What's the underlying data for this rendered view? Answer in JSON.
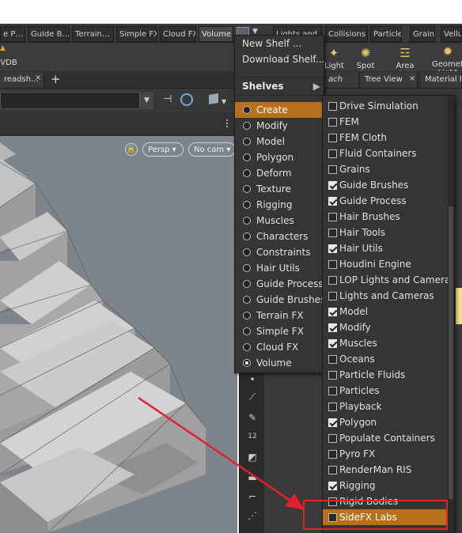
{
  "shelf_tabs": [
    "e P…",
    "Guide B…",
    "Terrain…",
    "Simple FX",
    "Cloud FX",
    "Volume",
    "Lights and…",
    "Collisions",
    "Particles",
    "Grains",
    "Vellum"
  ],
  "tools": {
    "left_partial": "VDB",
    "light": "Light",
    "spot_light": "Spot Light",
    "area_light": "Area Light",
    "geometry_light": "Geometry Light"
  },
  "pane_tabs": {
    "spreadsheet": "readsh…",
    "close": "×",
    "add": "+",
    "right1": "ach",
    "tree_view": "Tree View",
    "material": "Material Pa",
    "close2": "×"
  },
  "viewport": {
    "persp": "Persp",
    "nocam": "No cam"
  },
  "shelf_menu": {
    "new_shelf": "New Shelf ...",
    "download_shelf": "Download Shelf...",
    "shelves_header": "Shelves",
    "items": [
      {
        "label": "Create",
        "selected": false,
        "highlighted": true
      },
      {
        "label": "Modify",
        "selected": false
      },
      {
        "label": "Model",
        "selected": false
      },
      {
        "label": "Polygon",
        "selected": false
      },
      {
        "label": "Deform",
        "selected": false
      },
      {
        "label": "Texture",
        "selected": false
      },
      {
        "label": "Rigging",
        "selected": false
      },
      {
        "label": "Muscles",
        "selected": false
      },
      {
        "label": "Characters",
        "selected": false
      },
      {
        "label": "Constraints",
        "selected": false
      },
      {
        "label": "Hair Utils",
        "selected": false
      },
      {
        "label": "Guide Process",
        "selected": false
      },
      {
        "label": "Guide Brushes",
        "selected": false
      },
      {
        "label": "Terrain FX",
        "selected": false
      },
      {
        "label": "Simple FX",
        "selected": false
      },
      {
        "label": "Cloud FX",
        "selected": false
      },
      {
        "label": "Volume",
        "selected": true
      }
    ]
  },
  "shelves_submenu": {
    "items": [
      {
        "label": "Drive Simulation",
        "checked": false
      },
      {
        "label": "FEM",
        "checked": false
      },
      {
        "label": "FEM Cloth",
        "checked": false
      },
      {
        "label": "Fluid Containers",
        "checked": false
      },
      {
        "label": "Grains",
        "checked": false
      },
      {
        "label": "Guide Brushes",
        "checked": true
      },
      {
        "label": "Guide Process",
        "checked": true
      },
      {
        "label": "Hair Brushes",
        "checked": false
      },
      {
        "label": "Hair Tools",
        "checked": false
      },
      {
        "label": "Hair Utils",
        "checked": true
      },
      {
        "label": "Houdini Engine",
        "checked": false
      },
      {
        "label": "LOP Lights and Cameras",
        "checked": false
      },
      {
        "label": "Lights and Cameras",
        "checked": false
      },
      {
        "label": "Model",
        "checked": true
      },
      {
        "label": "Modify",
        "checked": true
      },
      {
        "label": "Muscles",
        "checked": true
      },
      {
        "label": "Oceans",
        "checked": false
      },
      {
        "label": "Particle Fluids",
        "checked": false
      },
      {
        "label": "Particles",
        "checked": false
      },
      {
        "label": "Playback",
        "checked": false
      },
      {
        "label": "Polygon",
        "checked": true
      },
      {
        "label": "Populate Containers",
        "checked": false
      },
      {
        "label": "Pyro FX",
        "checked": false
      },
      {
        "label": "RenderMan RIS",
        "checked": false
      },
      {
        "label": "Rigging",
        "checked": true
      },
      {
        "label": "Rigid Bodies",
        "checked": false
      },
      {
        "label": "SideFX Labs",
        "checked": false,
        "highlighted": true
      }
    ]
  },
  "colors": {
    "highlight": "#b8711a",
    "annotation": "#e0232a"
  },
  "icons": [
    "shelf-menu-icon",
    "submenu-arrow-icon",
    "lock-icon",
    "pin-icon",
    "snap-icon",
    "camera-box-icon"
  ]
}
